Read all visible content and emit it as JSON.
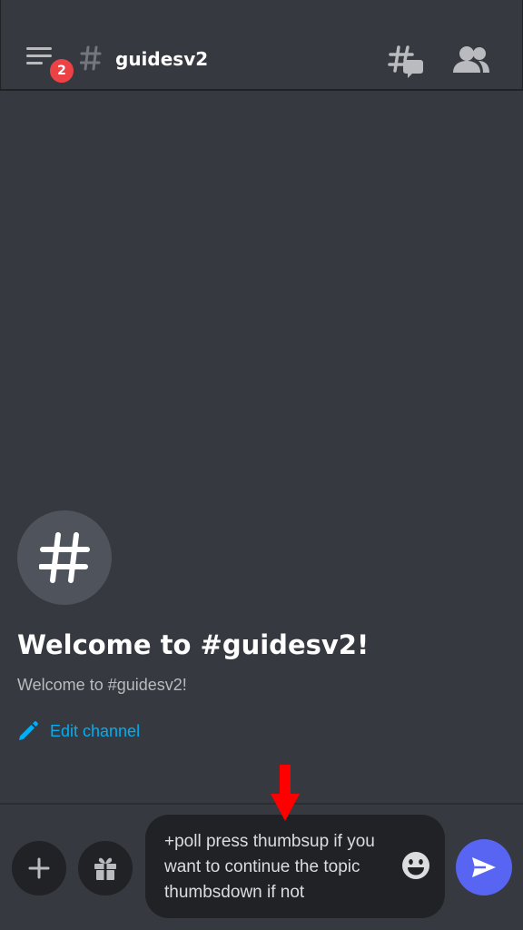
{
  "header": {
    "menu_icon": "hamburger-menu-icon",
    "unread_badge": "2",
    "channel_icon": "hash-icon",
    "channel_name": "guidesv2",
    "threads_icon": "threads-icon",
    "members_icon": "members-icon"
  },
  "welcome": {
    "icon": "hash-icon",
    "title": "Welcome to #guidesv2!",
    "subtitle": "Welcome to #guidesv2!",
    "edit_icon": "pencil-icon",
    "edit_label": "Edit channel"
  },
  "composer": {
    "add_icon": "plus-icon",
    "gift_icon": "gift-icon",
    "message_value": "+poll press thumbsup if you want to continue the topic thumbsdown if not",
    "emoji_icon": "emoji-icon",
    "send_icon": "send-icon",
    "annotation_icon": "red-arrow-icon"
  },
  "colors": {
    "background": "#36393f",
    "input_background": "#202225",
    "accent": "#5865f2",
    "badge": "#ed4245",
    "link": "#00aff4",
    "annotation_arrow": "#ff0000"
  }
}
